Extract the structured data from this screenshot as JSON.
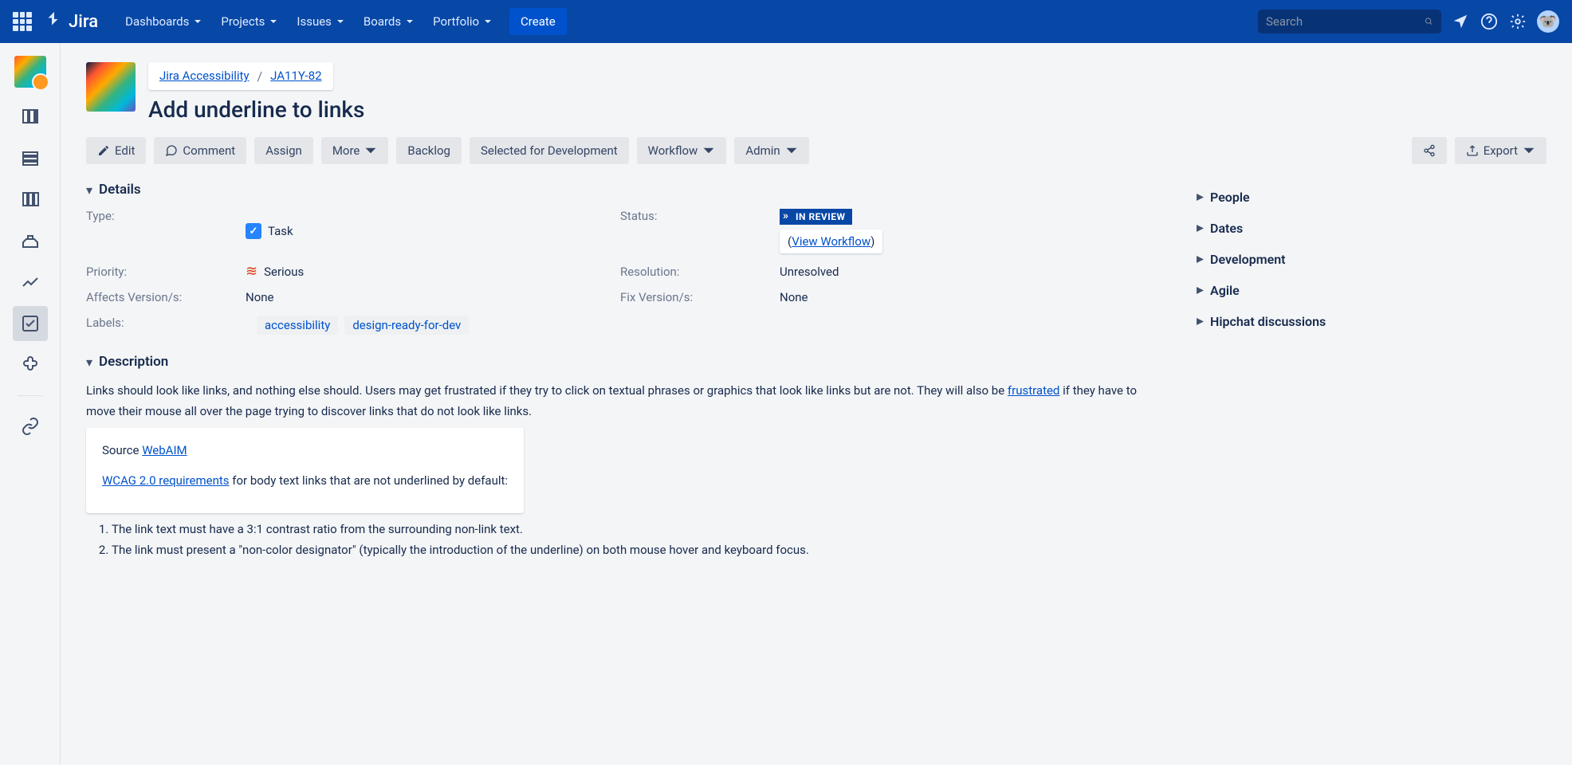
{
  "topnav": {
    "logo": "Jira",
    "items": [
      "Dashboards",
      "Projects",
      "Issues",
      "Boards",
      "Portfolio"
    ],
    "create": "Create",
    "search_placeholder": "Search"
  },
  "breadcrumb": {
    "project": "Jira Accessibility",
    "issue_key": "JA11Y-82"
  },
  "issue_title": "Add underline to links",
  "actions": {
    "edit": "Edit",
    "comment": "Comment",
    "assign": "Assign",
    "more": "More",
    "backlog": "Backlog",
    "selected": "Selected for Development",
    "workflow": "Workflow",
    "admin": "Admin",
    "export": "Export"
  },
  "sections": {
    "details": "Details",
    "description": "Description"
  },
  "details": {
    "type_label": "Type:",
    "type_value": "Task",
    "status_label": "Status:",
    "status_value": "IN REVIEW",
    "view_workflow": "View Workflow",
    "priority_label": "Priority:",
    "priority_value": "Serious",
    "resolution_label": "Resolution:",
    "resolution_value": "Unresolved",
    "affects_label": "Affects Version/s:",
    "affects_value": "None",
    "fix_label": "Fix Version/s:",
    "fix_value": "None",
    "labels_label": "Labels:",
    "labels": [
      "accessibility",
      "design-ready-for-dev"
    ]
  },
  "description": {
    "para1_a": "Links should look like links, and nothing else should. Users may get frustrated if they try to click on textual phrases or graphics that look like links but are not. They will also be ",
    "para1_link": "frustrated",
    "para1_b": " if they have to move their mouse all over the page trying to discover links that do not look like links.",
    "source_label": "Source ",
    "source_link": "WebAIM",
    "wcag_link": "WCAG 2.0 requirements",
    "wcag_rest": " for body text links that are not underlined by default:",
    "list": [
      "The link text must have a 3:1 contrast ratio from the surrounding non-link text.",
      "The link must present a \"non-color designator\" (typically the introduction of the underline) on both mouse hover and keyboard focus."
    ]
  },
  "right_panels": [
    "People",
    "Dates",
    "Development",
    "Agile",
    "Hipchat discussions"
  ]
}
